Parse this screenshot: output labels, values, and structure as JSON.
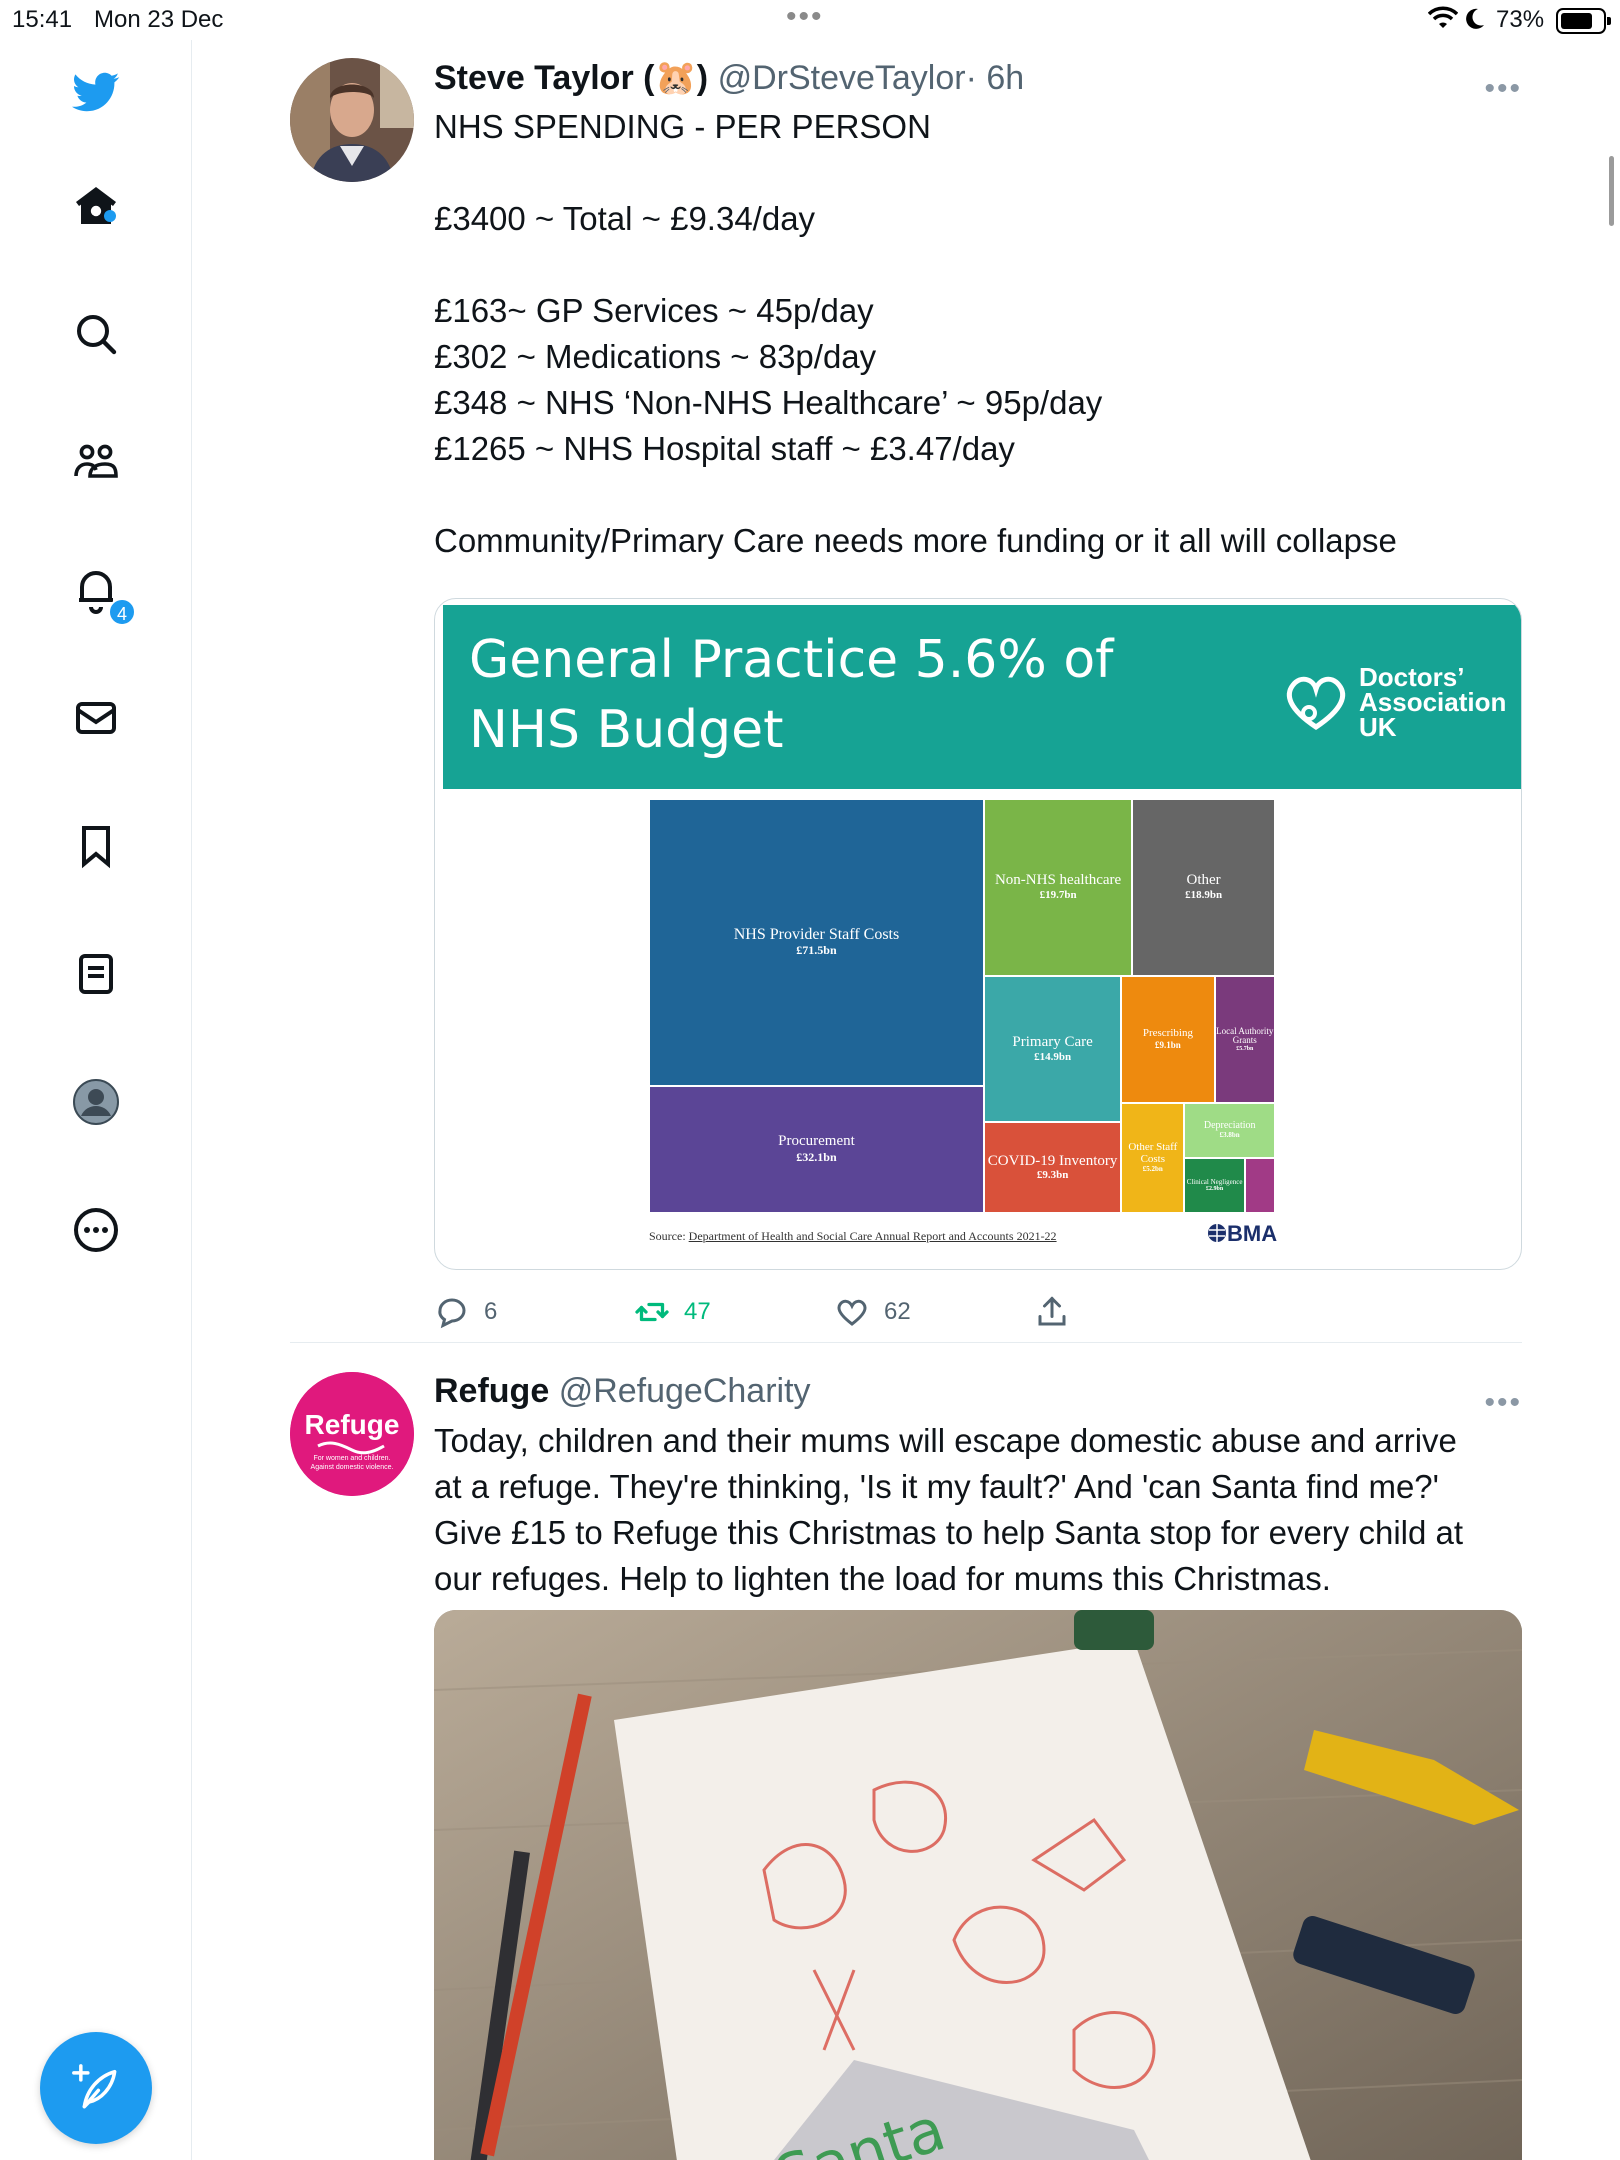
{
  "status_bar": {
    "time": "15:41",
    "date": "Mon 23 Dec",
    "battery_percent": "73%",
    "battery_level": 0.73
  },
  "sidebar": {
    "items": [
      {
        "icon": "twitter-bird-logo-icon"
      },
      {
        "icon": "home-icon",
        "has_dot": true
      },
      {
        "icon": "search-icon"
      },
      {
        "icon": "communities-icon"
      },
      {
        "icon": "notifications-bell-icon",
        "badge": "4"
      },
      {
        "icon": "messages-envelope-icon"
      },
      {
        "icon": "bookmark-icon"
      },
      {
        "icon": "lists-icon"
      },
      {
        "icon": "profile-avatar-icon"
      },
      {
        "icon": "more-options-circle-icon"
      }
    ],
    "compose_icon": "compose-feather-plus-icon"
  },
  "tweets": [
    {
      "name": "Steve Taylor (🐹)",
      "handle": "@DrSteveTaylor",
      "time": "· 6h",
      "more": "•••",
      "lines": [
        "NHS SPENDING - PER PERSON",
        "",
        "£3400 ~ Total ~ £9.34/day",
        "",
        "£163~ GP Services ~ 45p/day",
        "£302 ~ Medications ~ 83p/day",
        "£348 ~ NHS ‘Non-NHS Healthcare’ ~ 95p/day",
        "£1265 ~ NHS Hospital staff ~ £3.47/day",
        "",
        "Community/Primary Care needs more funding or it all will collapse"
      ],
      "image": {
        "banner_title_line1": "General Practice 5.6% of",
        "banner_title_line2": "NHS Budget",
        "brand_line1": "Doctors’",
        "brand_line2": "Association",
        "brand_line3": "UK",
        "banner_color": "#16a394",
        "source_label": "Source:",
        "source_text": "Department of Health and Social Care Annual Report and Accounts 2021-22",
        "bma_label": "BMA"
      },
      "actions": {
        "replies": "6",
        "retweets": "47",
        "likes": "62"
      }
    },
    {
      "name": "Refuge",
      "handle": "@RefugeCharity",
      "more": "•••",
      "avatar_text": "Refuge",
      "avatar_subtext_line1": "For women and children.",
      "avatar_subtext_line2": "Against domestic violence.",
      "avatar_color": "#e0197d",
      "lines": [
        "Today, children and their mums will escape domestic abuse and arrive",
        "at a refuge. They're thinking, 'Is it my fault?' And 'can Santa find me?'",
        "Give £15 to Refuge this Christmas to help Santa stop for every child at",
        "our refuges. Help to lighten the load for mums this Christmas."
      ],
      "image_text": "Santa"
    }
  ],
  "chart_data": {
    "type": "treemap",
    "units": "£bn",
    "items": [
      {
        "label": "NHS Provider Staff Costs",
        "value": 71.5,
        "value_label": "£71.5bn",
        "color": "#1f6597"
      },
      {
        "label": "Procurement",
        "value": 32.1,
        "value_label": "£32.1bn",
        "color": "#5b4596"
      },
      {
        "label": "Non-NHS healthcare",
        "value": 19.7,
        "value_label": "£19.7bn",
        "color": "#7ab548"
      },
      {
        "label": "Other",
        "value": 18.9,
        "value_label": "£18.9bn",
        "color": "#666666"
      },
      {
        "label": "Primary Care",
        "value": 14.9,
        "value_label": "£14.9bn",
        "color": "#3ba8a8"
      },
      {
        "label": "Prescribing",
        "value": 9.1,
        "value_label": "£9.1bn",
        "color": "#ee8a0e"
      },
      {
        "label": "Local Authority Grants",
        "value": 5.7,
        "value_label": "£5.7bn",
        "color": "#7a3a7c"
      },
      {
        "label": "COVID-19 Inventory",
        "value": 9.3,
        "value_label": "£9.3bn",
        "color": "#d9513a"
      },
      {
        "label": "Other Staff Costs",
        "value": 5.2,
        "value_label": "£5.2bn",
        "color": "#f0b518"
      },
      {
        "label": "Depreciation",
        "value": 3.8,
        "value_label": "£3.8bn",
        "color": "#9fdc86"
      },
      {
        "label": "Clinical Negligence",
        "value": 2.9,
        "value_label": "£2.9bn",
        "color": "#208a4a"
      },
      {
        "label": "",
        "value_label": "",
        "color": "#a13a86"
      }
    ]
  }
}
